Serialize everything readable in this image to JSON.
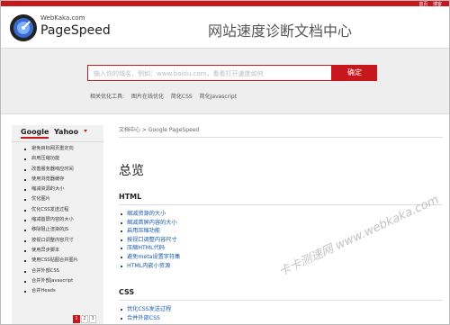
{
  "topbar": {
    "links": [
      "首页",
      "博客"
    ]
  },
  "brand": {
    "small": "WebKaka.com",
    "name": "PageSpeed"
  },
  "site_title": "网站速度诊断文档中心",
  "search": {
    "placeholder": "输入你的域名，例如：www.baidu.com，看看打开速度如何",
    "button": "确定"
  },
  "tools": {
    "label": "相关优化工具:",
    "items": [
      "图片在线优化",
      "简化CSS",
      "简化Javascript"
    ]
  },
  "sidebar": {
    "tabs": [
      "Google",
      "Yahoo"
    ],
    "items": [
      "避免目标网页重定向",
      "启用压缩功能",
      "改善服务器响应时间",
      "使用浏览器缓存",
      "缩减资源的大小",
      "优化图片",
      "优化CSS发送过程",
      "缩减首屏内容的大小",
      "移除阻止渲染的JS",
      "按视口调整内容尺寸",
      "使用异步脚本",
      "使用CSS贴图合并图片",
      "合并外部CSS",
      "合并外部Javascript",
      "合并Heads"
    ],
    "pages": [
      "1",
      "2",
      "3"
    ]
  },
  "content": {
    "breadcrumb": "文档中心 > Google PageSpeed",
    "title": "总览",
    "sections": [
      {
        "heading": "HTML",
        "links": [
          "缩减资源的大小",
          "缩减首屏内容的大小",
          "启用压缩功能",
          "按视口调整内容尺寸",
          "压缩HTML代码",
          "避免meta设置字符集",
          "HTML内嵌小资源"
        ]
      },
      {
        "heading": "CSS",
        "links": [
          "优化CSS发送过程",
          "合并外部CSS"
        ]
      }
    ]
  },
  "watermark": {
    "text": "卡卡测速网 www.webkaka.com"
  },
  "colors": {
    "accent": "#c8161d",
    "link": "#1a5aaa"
  }
}
